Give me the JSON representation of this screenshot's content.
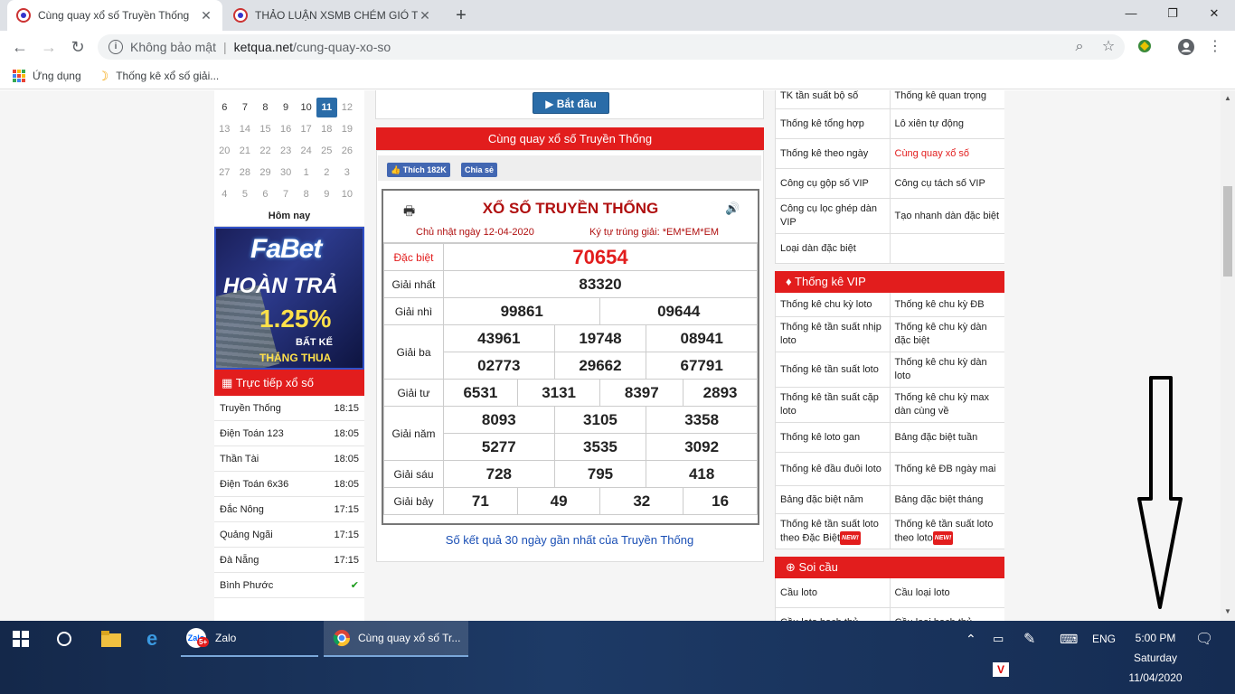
{
  "browser": {
    "tabs": [
      {
        "title": "Cùng quay xổ số Truyền Thống",
        "active": true
      },
      {
        "title": "THẢO LUẬN XSMB CHÉM GIÓ TỪ",
        "active": false
      }
    ],
    "new_tab": "+",
    "security_label": "Không bảo mật",
    "url_domain": "ketqua.net",
    "url_path": "/cung-quay-xo-so",
    "bookmarks": [
      {
        "label": "Ứng dụng",
        "icon": "apps-grid-icon"
      },
      {
        "label": "Thống kê xổ số giải...",
        "icon": "bookmark-favicon"
      }
    ]
  },
  "calendar": {
    "rows": [
      [
        {
          "d": "6"
        },
        {
          "d": "7"
        },
        {
          "d": "8"
        },
        {
          "d": "9"
        },
        {
          "d": "10"
        },
        {
          "d": "11",
          "today": true
        },
        {
          "d": "12",
          "dim": true
        }
      ],
      [
        {
          "d": "13",
          "dim": true
        },
        {
          "d": "14",
          "dim": true
        },
        {
          "d": "15",
          "dim": true
        },
        {
          "d": "16",
          "dim": true
        },
        {
          "d": "17",
          "dim": true
        },
        {
          "d": "18",
          "dim": true
        },
        {
          "d": "19",
          "dim": true
        }
      ],
      [
        {
          "d": "20",
          "dim": true
        },
        {
          "d": "21",
          "dim": true
        },
        {
          "d": "22",
          "dim": true
        },
        {
          "d": "23",
          "dim": true
        },
        {
          "d": "24",
          "dim": true
        },
        {
          "d": "25",
          "dim": true
        },
        {
          "d": "26",
          "dim": true
        }
      ],
      [
        {
          "d": "27",
          "dim": true
        },
        {
          "d": "28",
          "dim": true
        },
        {
          "d": "29",
          "dim": true
        },
        {
          "d": "30",
          "dim": true
        },
        {
          "d": "1",
          "dim": true
        },
        {
          "d": "2",
          "dim": true
        },
        {
          "d": "3",
          "dim": true
        }
      ],
      [
        {
          "d": "4",
          "dim": true
        },
        {
          "d": "5",
          "dim": true
        },
        {
          "d": "6",
          "dim": true
        },
        {
          "d": "7",
          "dim": true
        },
        {
          "d": "8",
          "dim": true
        },
        {
          "d": "9",
          "dim": true
        },
        {
          "d": "10",
          "dim": true
        }
      ]
    ],
    "today_label": "Hôm nay"
  },
  "banner": {
    "logo": "FaBet",
    "line1": "HOÀN TRẢ",
    "percent": "1.25%",
    "line2": "BẤT KỂ",
    "line3": "THẮNG THUA"
  },
  "live": {
    "title": "Trực tiếp xổ số",
    "items": [
      {
        "name": "Truyền Thống",
        "time": "18:15"
      },
      {
        "name": "Điện Toán 123",
        "time": "18:05"
      },
      {
        "name": "Thần Tài",
        "time": "18:05"
      },
      {
        "name": "Điện Toán 6x36",
        "time": "18:05"
      },
      {
        "name": "Đắc Nông",
        "time": "17:15"
      },
      {
        "name": "Quảng Ngãi",
        "time": "17:15"
      },
      {
        "name": "Đà Nẵng",
        "time": "17:15"
      },
      {
        "name": "Bình Phước",
        "time": "✔"
      }
    ]
  },
  "center": {
    "start_button": "Bắt đầu",
    "section_title": "Cùng quay xổ số Truyền Thống",
    "fb_like": "Thích 182K",
    "fb_share": "Chia sẻ",
    "result_title": "XỔ SỐ TRUYỀN THỐNG",
    "date_line": "Chủ nhật ngày 12-04-2020",
    "ky_tu_line": "Ký tự trúng giải: *EM*EM*EM",
    "prizes": {
      "db_label": "Đặc biệt",
      "db": "70654",
      "g1_label": "Giải nhất",
      "g1": "83320",
      "g2_label": "Giải nhì",
      "g2": [
        "99861",
        "09644"
      ],
      "g3_label": "Giải ba",
      "g3": [
        "43961",
        "19748",
        "08941",
        "02773",
        "29662",
        "67791"
      ],
      "g4_label": "Giải tư",
      "g4": [
        "6531",
        "3131",
        "8397",
        "2893"
      ],
      "g5_label": "Giải năm",
      "g5": [
        "8093",
        "3105",
        "3358",
        "5277",
        "3535",
        "3092"
      ],
      "g6_label": "Giải sáu",
      "g6": [
        "728",
        "795",
        "418"
      ],
      "g7_label": "Giải bảy",
      "g7": [
        "71",
        "49",
        "32",
        "16"
      ]
    },
    "recent_link": "Số kết quả 30 ngày gần nhất của Truyền Thống"
  },
  "right": {
    "tools": [
      [
        "TK tần suất bộ số",
        "Thống kê quan trọng"
      ],
      [
        "Thống kê tổng hợp",
        "Lô xiên tự động"
      ],
      [
        "Thống kê theo ngày",
        "Cùng quay xổ số"
      ],
      [
        "Công cụ gộp số VIP",
        "Công cụ tách số VIP"
      ],
      [
        "Công cụ lọc ghép dàn VIP",
        "Tạo nhanh dàn đặc biệt"
      ],
      [
        "Loại dàn đặc biệt",
        ""
      ]
    ],
    "vip_title": "Thống kê VIP",
    "vip": [
      [
        "Thống kê chu kỳ loto",
        "Thống kê chu kỳ ĐB"
      ],
      [
        "Thống kê tần suất nhịp loto",
        "Thống kê chu kỳ dàn đặc biệt"
      ],
      [
        "Thống kê tần suất loto",
        "Thống kê chu kỳ dàn loto"
      ],
      [
        "Thống kê tần suất cặp loto",
        "Thống kê chu kỳ max dàn cùng về"
      ],
      [
        "Thống kê loto gan",
        "Bảng đặc biệt tuần"
      ],
      [
        "Thống kê đầu đuôi loto",
        "Thống kê ĐB ngày mai"
      ],
      [
        "Bảng đặc biệt năm",
        "Bảng đặc biệt tháng"
      ],
      [
        "Thống kê tần suất loto theo Đặc Biệt",
        "Thống kê tần suất loto theo loto"
      ]
    ],
    "new_badge": "NEW!",
    "soi_title": "Soi cầu",
    "soi": [
      [
        "Cầu loto",
        "Cầu loại loto"
      ],
      [
        "Cầu loto bạch thủ",
        "Cầu loại bạch thủ"
      ]
    ]
  },
  "taskbar": {
    "zalo_label": "Zalo",
    "zalo_badge": "5+",
    "chrome_label": "Cùng quay xổ số Tr...",
    "lang": "ENG",
    "time": "5:00 PM",
    "day": "Saturday",
    "date": "11/04/2020"
  }
}
